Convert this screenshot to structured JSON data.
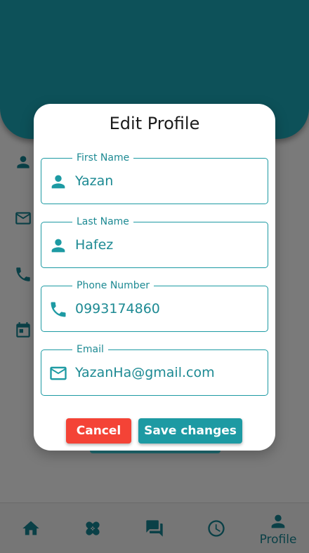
{
  "colors": {
    "accent": "#1d9aa3",
    "header": "#0d5159",
    "cancel": "#f44336",
    "overlay": "#7a7a7a"
  },
  "background": {
    "side_icons": [
      "person-icon",
      "email-icon",
      "phone-icon",
      "calendar-icon"
    ]
  },
  "dialog": {
    "title": "Edit Profile",
    "fields": [
      {
        "label": "First Name",
        "value": "Yazan",
        "icon": "person-icon"
      },
      {
        "label": "Last Name",
        "value": "Hafez",
        "icon": "person-icon"
      },
      {
        "label": "Phone Number",
        "value": "0993174860",
        "icon": "phone-icon"
      },
      {
        "label": "Email",
        "value": "YazanHa@gmail.com",
        "icon": "email-icon"
      }
    ],
    "cancel_label": "Cancel",
    "save_label": "Save changes"
  },
  "bottom_nav": {
    "items": [
      {
        "icon": "home-icon"
      },
      {
        "icon": "bandage-icon"
      },
      {
        "icon": "chat-icon"
      },
      {
        "icon": "clock-icon"
      },
      {
        "icon": "profile-icon",
        "label": "Profile",
        "active": true
      }
    ]
  }
}
